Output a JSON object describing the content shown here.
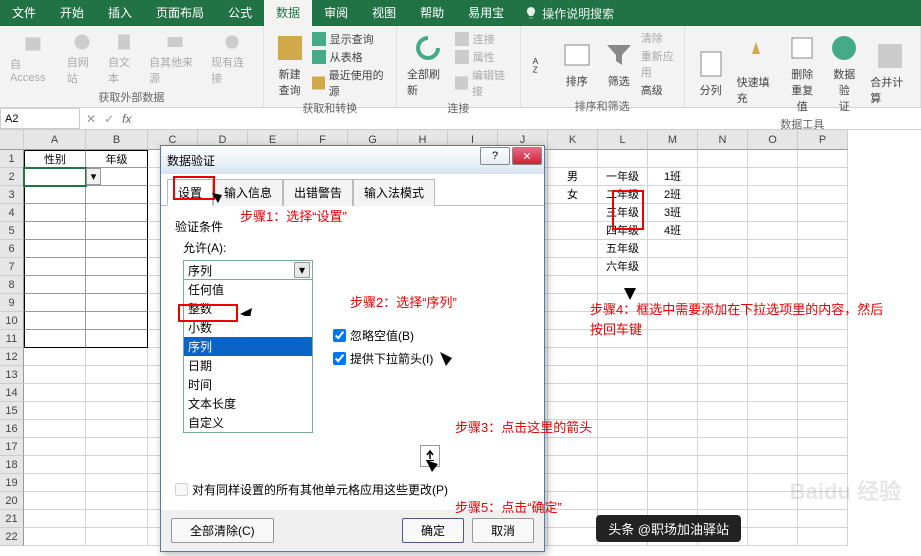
{
  "ribbon": {
    "tabs": [
      "文件",
      "开始",
      "插入",
      "页面布局",
      "公式",
      "数据",
      "审阅",
      "视图",
      "帮助",
      "易用宝"
    ],
    "active_tab": "数据",
    "tell_me": "操作说明搜索"
  },
  "groups": {
    "get_external": {
      "items": [
        "自 Access",
        "自网站",
        "自文本",
        "自其他来源",
        "现有连接"
      ],
      "label": "获取外部数据"
    },
    "get_transform": {
      "new_query": "新建\n查询",
      "show_query": "显示查询",
      "from_table": "从表格",
      "recent_sources": "最近使用的源",
      "label": "获取和转换"
    },
    "connections": {
      "refresh_all": "全部刷新",
      "connections": "连接",
      "properties": "属性",
      "edit_links": "编辑链接",
      "label": "连接"
    },
    "sort_filter": {
      "sort": "排序",
      "filter": "筛选",
      "clear": "清除",
      "reapply": "重新应用",
      "advanced": "高级",
      "label": "排序和筛选"
    },
    "data_tools": {
      "text_to_col": "分列",
      "flash_fill": "快速填充",
      "remove_dup": "删除\n重复值",
      "validation": "数据验\n证",
      "consolidate": "合并计算",
      "label": "数据工具"
    }
  },
  "name_box": "A2",
  "columns": [
    "A",
    "B",
    "C",
    "D",
    "E",
    "F",
    "G",
    "H",
    "I",
    "J",
    "K",
    "L",
    "M",
    "N",
    "O",
    "P"
  ],
  "rows_visible": 22,
  "headers": {
    "A1": "性别",
    "B1": "年级"
  },
  "sample_data": {
    "K2": "男",
    "K3": "女",
    "L2": "一年级",
    "L3": "二年级",
    "L4": "三年级",
    "L5": "四年级",
    "L6": "五年级",
    "L7": "六年级",
    "M2": "1班",
    "M3": "2班",
    "M4": "3班",
    "M5": "4班"
  },
  "dialog": {
    "title": "数据验证",
    "tabs": [
      "设置",
      "输入信息",
      "出错警告",
      "输入法模式"
    ],
    "active_tab": "设置",
    "criteria_label": "验证条件",
    "allow_label": "允许(A):",
    "allow_value": "序列",
    "allow_options": [
      "任何值",
      "整数",
      "小数",
      "序列",
      "日期",
      "时间",
      "文本长度",
      "自定义"
    ],
    "ignore_blank": "忽略空值(B)",
    "incell_dropdown": "提供下拉箭头(I)",
    "apply_all": "对有同样设置的所有其他单元格应用这些更改(P)",
    "clear_all": "全部清除(C)",
    "ok": "确定",
    "cancel": "取消"
  },
  "annotations": {
    "step1": "步骤1：选择“设置”",
    "step2": "步骤2：选择“序列”",
    "step3": "步骤3：点击这里的箭头",
    "step4": "步骤4：框选中需要添加在下拉选项里的内容，然后按回车键",
    "step5": "步骤5：点击“确定”"
  },
  "watermark": "Baidu 经验",
  "credit": "头条 @职场加油驿站"
}
